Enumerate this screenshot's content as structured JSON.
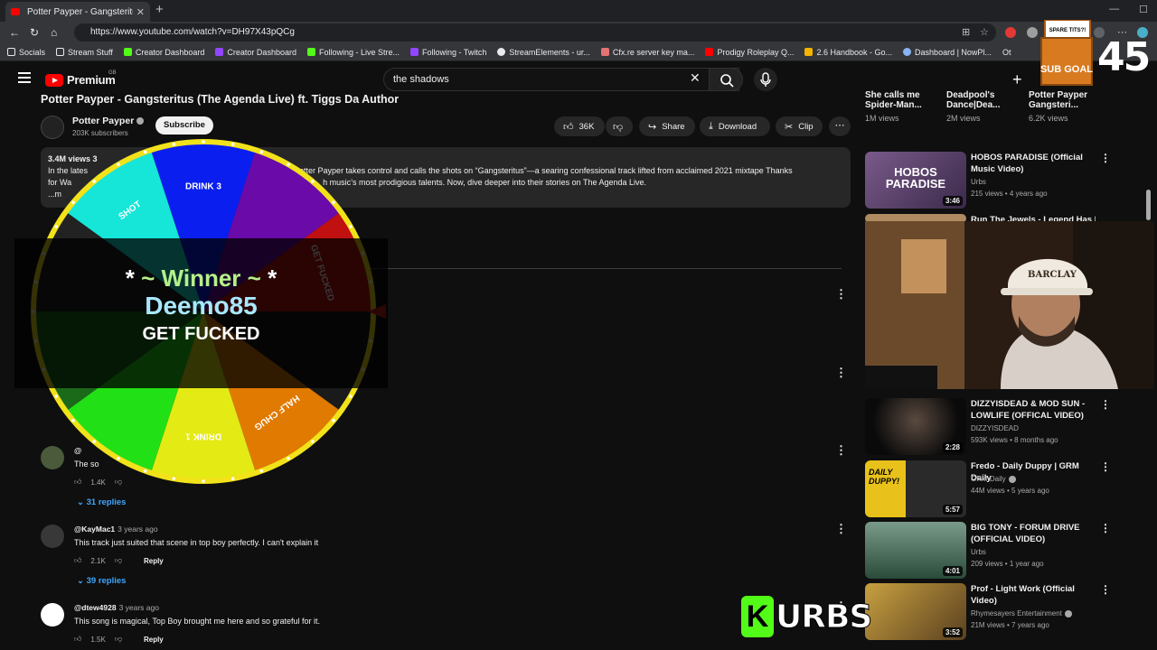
{
  "browser": {
    "tab_title": "Potter Payper - Gangsteritus (The",
    "url": "https://www.youtube.com/watch?v=DH97X43pQCg",
    "bookmarks": [
      "Socials",
      "Stream Stuff",
      "Creator Dashboard",
      "Creator Dashboard",
      "Following - Live Stre...",
      "Following - Twitch",
      "StreamElements - ur...",
      "Cfx.re server key ma...",
      "Prodigy Roleplay Q...",
      "2.6 Handbook - Go...",
      "Dashboard | NowPl..."
    ],
    "bookmark_colors": [
      "#8ab4f8",
      "#8ab4f8",
      "#53fc18",
      "#9146ff",
      "#53fc18",
      "#9146ff",
      "#e8eaed",
      "#e8eaed",
      "#f4b400",
      "#f4b400",
      "#8ab4f8"
    ],
    "bookmark_overflow": "Ot"
  },
  "youtube": {
    "logo_text": "Premium",
    "region": "GB",
    "search_query": "the shadows"
  },
  "video": {
    "title": "Potter Payper - Gangsteritus (The Agenda Live) ft. Tiggs Da Author",
    "channel": "Potter Payper",
    "subscribers": "203K subscribers",
    "subscribe_label": "Subscribe",
    "likes": "36K",
    "share_label": "Share",
    "download_label": "Download",
    "clip_label": "Clip",
    "views_meta": "3.4M views  3",
    "desc_line1_a": "In the lates",
    "desc_line1_b": "Potter Payper takes control and calls the shots on “Gangsteritus”—a searing confessional track lifted from acclaimed 2021 mixtape Thanks",
    "desc_line2_a": "for Wa",
    "desc_line2_b": "h music’s most prodigious talents. Now, dive deeper into their stories on The Agenda Live.",
    "desc_line3": "...m"
  },
  "comments": [
    {
      "user": "@",
      "time": "",
      "text": "The so",
      "likes": "1.4K",
      "replies": "31 replies"
    },
    {
      "user": "@KayMac1",
      "time": "3 years ago",
      "text": "This track just suited that scene in top boy perfectly. I can't explain it",
      "likes": "2.1K",
      "reply_label": "Reply",
      "replies": "39 replies"
    },
    {
      "user": "@dtew4928",
      "time": "3 years ago",
      "text": "This song is magical, Top Boy brought me here and so grateful for it.",
      "likes": "1.5K",
      "reply_label": "Reply"
    }
  ],
  "sidebar": {
    "top_row": [
      {
        "title": "She calls me Spider-Man...",
        "views": "1M views"
      },
      {
        "title": "Deadpool's Dance|Dea...",
        "views": "2M views"
      },
      {
        "title": "Potter Payper Gangsteri...",
        "views": "6.2K views"
      }
    ],
    "recs": [
      {
        "title": "HOBOS PARADISE (Official Music Video)",
        "channel": "Urbs",
        "meta": "215 views • 4 years ago",
        "duration": "3:46",
        "thumb_text": "HOBOS PARADISE",
        "color": "#6a4c7a"
      },
      {
        "title": "Run The Jewels - Legend Has It",
        "channel": "",
        "meta": "",
        "duration": "",
        "color": "#b08a60"
      },
      {
        "title": "DIZZYISDEAD & MOD SUN - LOWLIFE (OFFICAL VIDEO)",
        "channel": "DIZZYISDEAD",
        "meta": "593K views • 8 months ago",
        "duration": "2:28",
        "color": "#1a1a1a"
      },
      {
        "title": "Fredo - Daily Duppy | GRM Daily",
        "channel": "GRM Daily",
        "meta": "44M views • 5 years ago",
        "duration": "5:57",
        "thumb_text": "DAILY DUPPY!",
        "color": "#e8c21a"
      },
      {
        "title": "BIG TONY - FORUM DRIVE (OFFICIAL VIDEO)",
        "channel": "Urbs",
        "meta": "209 views • 1 year ago",
        "duration": "4:01",
        "color": "#3a5a4a"
      },
      {
        "title": "Prof - Light Work (Official Video)",
        "channel": "Rhymesayers Entertainment",
        "meta": "21M views • 7 years ago",
        "duration": "3:52",
        "color": "#8a6a2a"
      }
    ]
  },
  "overlay": {
    "sub_goal_top": "SPARE TITS?!",
    "sub_goal_label": "SUB GOAL",
    "goal_count": "45",
    "kick_letter": "K",
    "kick_name": "URBS",
    "wheel_segments": [
      {
        "label": "DRINK 3",
        "color": "#0a1ef0"
      },
      {
        "label": "",
        "color": "#6a0aa8"
      },
      {
        "label": "GET FUCKED",
        "color": "#c01010"
      },
      {
        "label": "",
        "color": "#1a1a1a"
      },
      {
        "label": "HALF CHUG",
        "color": "#e07a00"
      },
      {
        "label": "DRINK 1",
        "color": "#e4ea14"
      },
      {
        "label": "",
        "color": "#22e016"
      },
      {
        "label": "",
        "color": "#1a6a1a"
      },
      {
        "label": "",
        "color": "#222222"
      },
      {
        "label": "SHOT",
        "color": "#15e6d8"
      }
    ],
    "winner_line1": "~ Winner ~",
    "winner_star": "*",
    "winner_name": "Deemo85",
    "winner_result": "GET FUCKED"
  }
}
